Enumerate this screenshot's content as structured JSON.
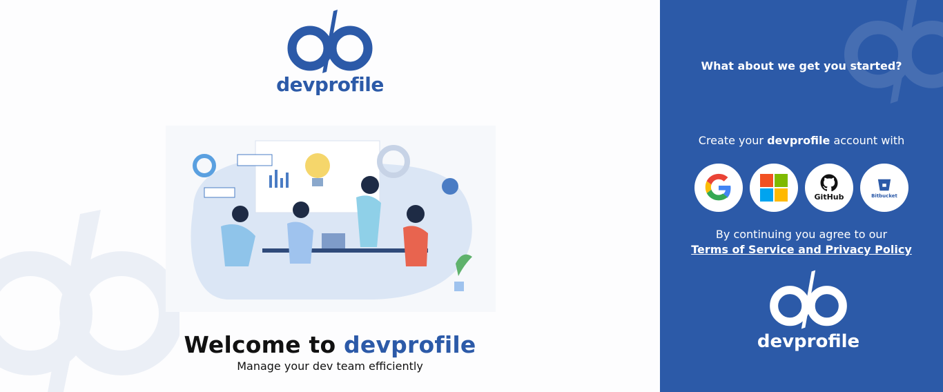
{
  "left": {
    "logo_text": "devprofile",
    "welcome_prefix": "Welcome to",
    "welcome_brand": "devprofile",
    "tagline": "Manage your dev team efficiently"
  },
  "right": {
    "question": "What about we get you started?",
    "create_prefix": "Create your",
    "create_brand": "devprofile",
    "create_suffix": "account with",
    "providers": [
      {
        "name": "Google",
        "icon": "google-icon"
      },
      {
        "name": "Microsoft",
        "icon": "microsoft-icon"
      },
      {
        "name": "GitHub",
        "icon": "github-icon",
        "label": "GitHub"
      },
      {
        "name": "Bitbucket",
        "icon": "bitbucket-icon",
        "label": "Bitbucket"
      }
    ],
    "agree_text": "By continuing you agree to our",
    "terms_link": "Terms of Service and Privacy Policy",
    "logo_text": "devprofile"
  },
  "colors": {
    "brand": "#2c5aa8",
    "panel": "#2c5aa8",
    "text": "#111111"
  }
}
